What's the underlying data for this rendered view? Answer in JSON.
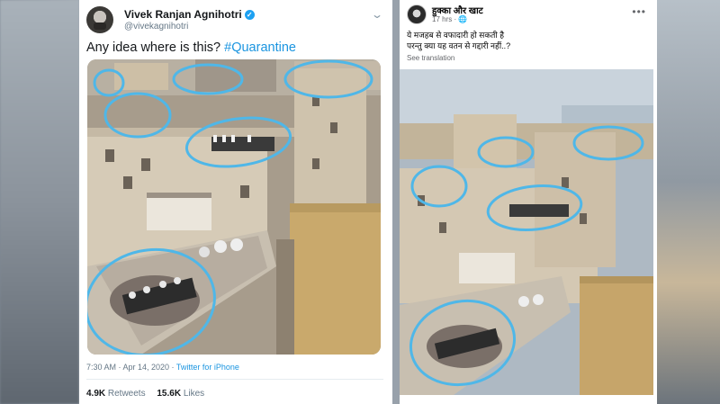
{
  "twitter": {
    "user_name": "Vivek Ranjan Agnihotri",
    "handle": "@vivekagnihotri",
    "tweet_text_plain": "Any idea where is this? ",
    "tweet_hashtag": "#Quarantine",
    "timestamp": "7:30 AM · Apr 14, 2020 · ",
    "source": "Twitter for iPhone",
    "retweets_count": "4.9K",
    "retweets_label": " Retweets",
    "likes_count": "15.6K",
    "likes_label": " Likes"
  },
  "facebook": {
    "page_name": "हुक्का और खाट",
    "time": "17 hrs · ",
    "post_line1": "ये मजहब से वफादारी हो सकती है",
    "post_line2": "परन्तु क्या यह वतन से गद्दारी नहीं..?",
    "see_translation": "See translation"
  },
  "colors": {
    "twitter_blue": "#1da1f2",
    "hashtag_blue": "#1b95e0",
    "circle_annotation": "#4fb7e8"
  },
  "icons": [
    "verified-badge-icon",
    "chevron-down-icon",
    "more-options-icon",
    "globe-icon"
  ]
}
